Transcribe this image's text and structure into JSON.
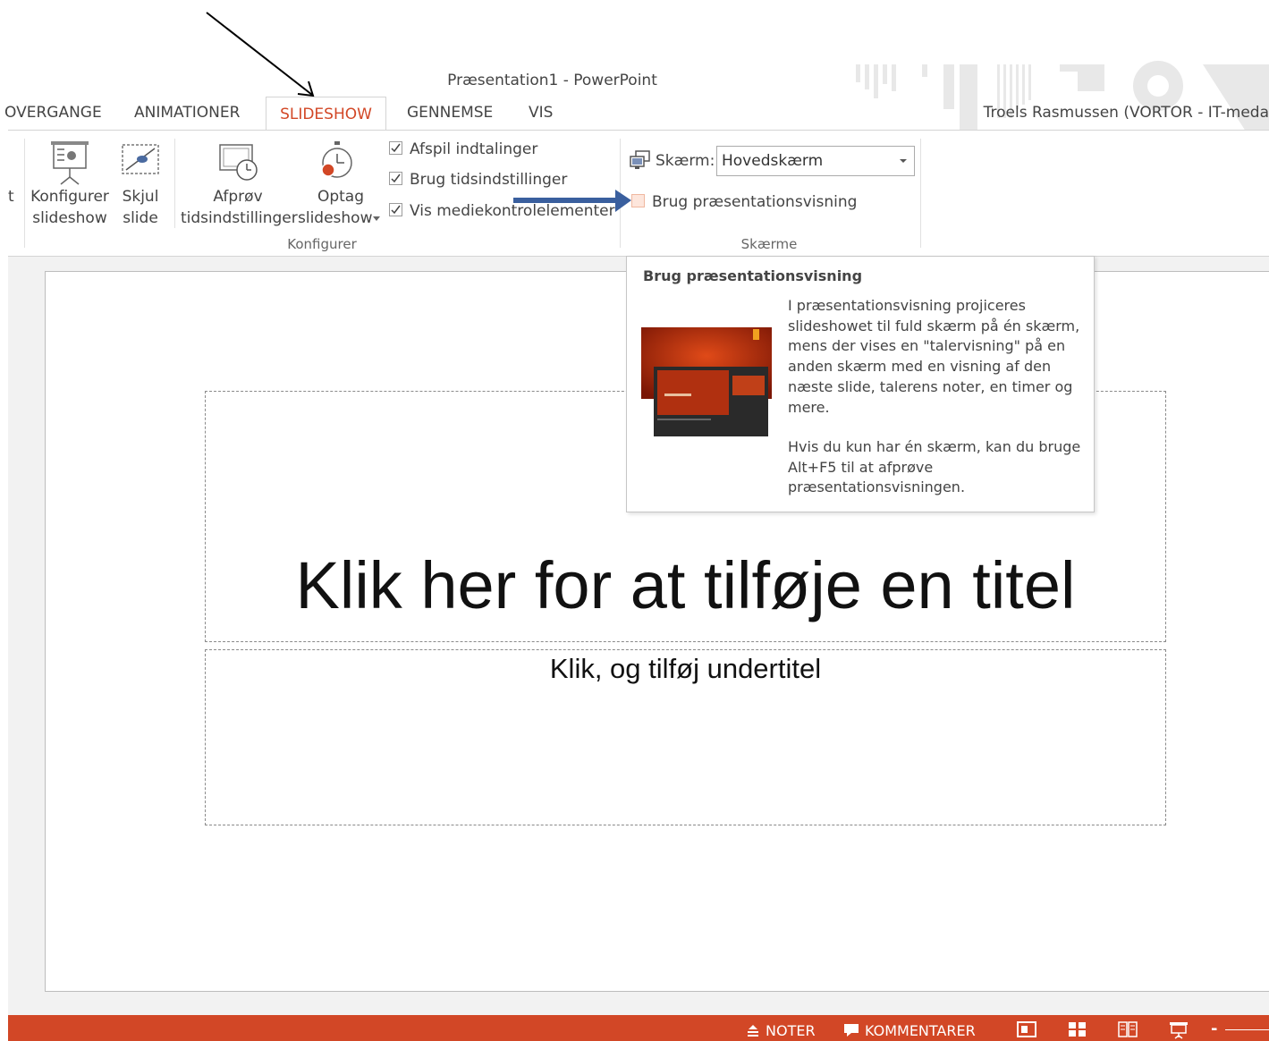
{
  "window": {
    "title": "Præsentation1 - PowerPoint",
    "user": "Troels Rasmussen (VORTOR - IT-meda"
  },
  "tabs": [
    {
      "label": "OVERGANGE"
    },
    {
      "label": "ANIMATIONER"
    },
    {
      "label": "SLIDESHOW",
      "active": true
    },
    {
      "label": "GENNEMSE"
    },
    {
      "label": "VIS"
    }
  ],
  "ribbon": {
    "partial_label": "t",
    "konfigurer_group": {
      "label": "Konfigurer",
      "buttons": [
        {
          "line1": "Konfigurer",
          "line2": "slideshow"
        },
        {
          "line1": "Skjul",
          "line2": "slide"
        },
        {
          "line1": "Afprøv",
          "line2": "tidsindstillinger"
        },
        {
          "line1": "Optag",
          "line2": "slideshow"
        }
      ],
      "checkboxes": [
        {
          "label": "Afspil indtalinger",
          "checked": true
        },
        {
          "label": "Brug tidsindstillinger",
          "checked": true
        },
        {
          "label": "Vis mediekontrolelementer",
          "checked": true
        }
      ]
    },
    "screens_group": {
      "label": "Skærme",
      "screen_label": "Skærm:",
      "screen_value": "Hovedskærm",
      "presenter_view_label": "Brug præsentationsvisning",
      "presenter_view_checked": false
    }
  },
  "tooltip": {
    "title": "Brug præsentationsvisning",
    "paragraph1": "I præsentationsvisning projiceres slideshowet til fuld skærm på én skærm, mens der vises en \"talervisning\" på en anden skærm med en visning af den næste slide, talerens noter, en timer og mere.",
    "paragraph2": "Hvis du kun har én skærm, kan du bruge Alt+F5 til at afprøve præsentationsvisningen."
  },
  "slide": {
    "title_placeholder": "Klik her for at tilføje en titel",
    "subtitle_placeholder": "Klik, og tilføj undertitel"
  },
  "statusbar": {
    "notes": "NOTER",
    "comments": "KOMMENTARER",
    "zoom_prefix": "-"
  },
  "colors": {
    "accent": "#d24726",
    "annotation_arrow": "#3a5f9e"
  }
}
